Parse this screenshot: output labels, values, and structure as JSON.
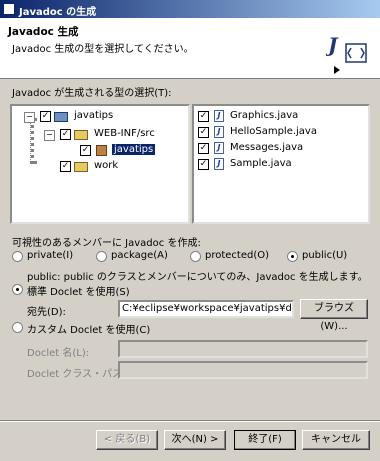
{
  "window": {
    "title": "Javadoc の生成"
  },
  "banner": {
    "heading": "Javadoc 生成",
    "description": "Javadoc 生成の型を選択してください。"
  },
  "types_label": "Javadoc が生成される型の選択(T):",
  "tree": {
    "root": "javatips",
    "webinf": "WEB-INF/src",
    "pkg": "javatips",
    "work": "work"
  },
  "files": [
    "Graphics.java",
    "HelloSample.java",
    "Messages.java",
    "Sample.java"
  ],
  "visibility": {
    "label": "可視性のあるメンバーに Javadoc を作成:",
    "private": "private(I)",
    "package": "package(A)",
    "protected": "protected(O)",
    "public": "public(U)",
    "description": "public: public のクラスとメンバーについてのみ、Javadoc を生成します。"
  },
  "standard_doclet": {
    "label": "標準 Doclet を使用(S)",
    "dest_label": "宛先(D):",
    "dest_value": "C:¥eclipse¥workspace¥javatips¥doc",
    "browse": "ブラウズ(W)..."
  },
  "custom_doclet": {
    "label": "カスタム Doclet を使用(C)",
    "name_label": "Doclet 名(L):",
    "path_label": "Doclet クラス・パス(P):"
  },
  "buttons": {
    "back": "< 戻る(B)",
    "next": "次へ(N) >",
    "finish": "終了(F)",
    "cancel": "キャンセル"
  }
}
